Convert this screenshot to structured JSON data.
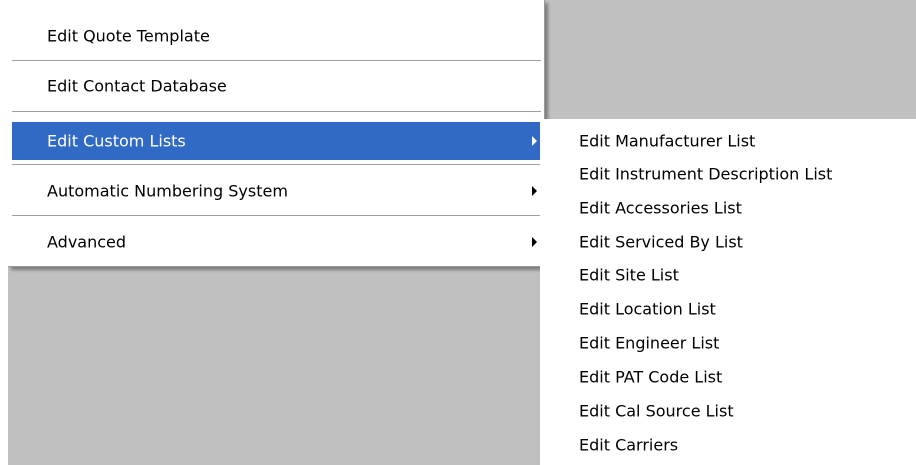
{
  "main_menu": {
    "items": [
      {
        "label": "Edit Quote Template",
        "has_submenu": false,
        "active": false
      },
      {
        "label": "Edit Contact Database",
        "has_submenu": false,
        "active": false
      },
      {
        "label": "Edit Custom Lists",
        "has_submenu": true,
        "active": true
      },
      {
        "label": "Automatic Numbering System",
        "has_submenu": true,
        "active": false
      },
      {
        "label": "Advanced",
        "has_submenu": true,
        "active": false
      }
    ]
  },
  "sub_menu": {
    "items": [
      {
        "label": "Edit Manufacturer List"
      },
      {
        "label": "Edit Instrument Description List"
      },
      {
        "label": "Edit Accessories List"
      },
      {
        "label": "Edit Serviced By List"
      },
      {
        "label": "Edit Site List"
      },
      {
        "label": "Edit Location List"
      },
      {
        "label": "Edit Engineer List"
      },
      {
        "label": "Edit PAT Code List"
      },
      {
        "label": "Edit Cal Source List"
      },
      {
        "label": "Edit Carriers"
      }
    ]
  },
  "colors": {
    "highlight": "#316ac5",
    "background": "#c0c0c0",
    "menu_background": "#ffffff"
  },
  "icons": {
    "submenu_arrow": "chevron-right-icon"
  }
}
